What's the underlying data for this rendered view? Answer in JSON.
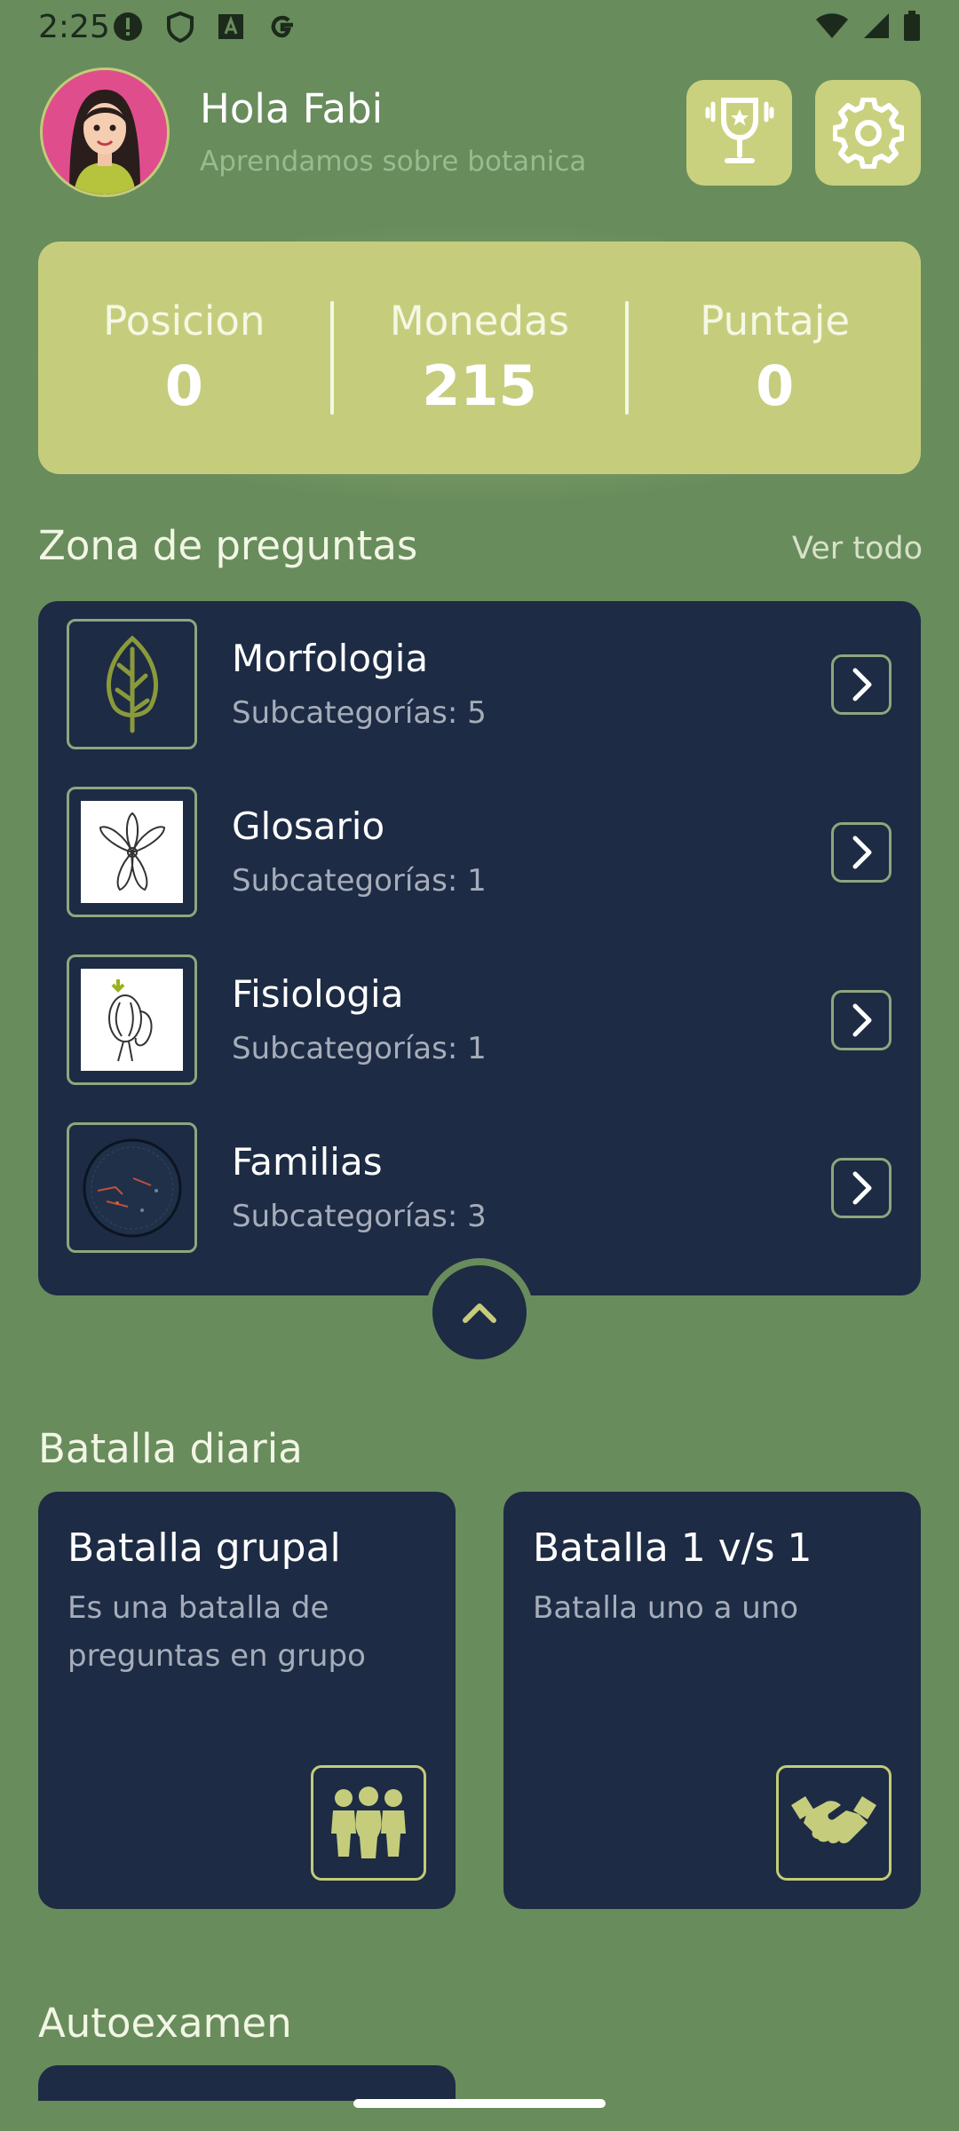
{
  "status_bar": {
    "time": "2:25"
  },
  "header": {
    "greeting": "Hola Fabi",
    "subtitle": "Aprendamos sobre botanica"
  },
  "stats": {
    "position": {
      "label": "Posicion",
      "value": "0"
    },
    "coins": {
      "label": "Monedas",
      "value": "215"
    },
    "score": {
      "label": "Puntaje",
      "value": "0"
    }
  },
  "questions": {
    "title": "Zona de preguntas",
    "see_all": "Ver todo",
    "categories": [
      {
        "name": "Morfologia",
        "subtitle": "Subcategorías: 5",
        "icon": "leaf-icon"
      },
      {
        "name": "Glosario",
        "subtitle": "Subcategorías: 1",
        "icon": "flower-drawing"
      },
      {
        "name": "Fisiologia",
        "subtitle": "Subcategorías: 1",
        "icon": "seed-drawing"
      },
      {
        "name": "Familias",
        "subtitle": "Subcategorías: 3",
        "icon": "circle-diagram"
      }
    ]
  },
  "daily_battle": {
    "title": "Batalla diaria",
    "group": {
      "title": "Batalla grupal",
      "description": "Es una batalla de preguntas en grupo",
      "icon": "group-icon"
    },
    "one_vs_one": {
      "title": "Batalla 1 v/s 1",
      "description": "Batalla uno a uno",
      "icon": "handshake-icon"
    }
  },
  "self_exam": {
    "title": "Autoexamen"
  },
  "colors": {
    "background": "#688c5c",
    "accent": "#c5cd7c",
    "panel": "#1d2b44"
  }
}
